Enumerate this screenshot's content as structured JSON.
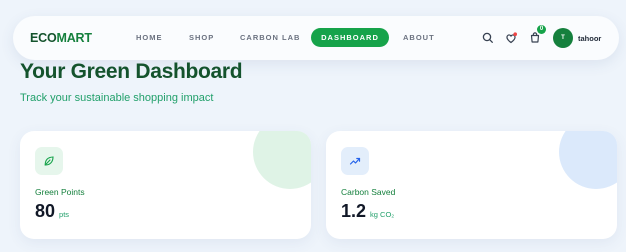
{
  "nav": {
    "logo_eco": "ECO",
    "logo_mart": "MART",
    "links": [
      "HOME",
      "SHOP",
      "CARBON LAB"
    ],
    "active": "DASHBOARD",
    "about": "ABOUT",
    "cart_count": "0",
    "avatar_initial": "T",
    "username": "tahoor",
    "icons": [
      "search-icon",
      "heart-icon",
      "cart-icon"
    ]
  },
  "page": {
    "title": "Your Green Dashboard",
    "subtitle": "Track your sustainable shopping impact"
  },
  "cards": [
    {
      "icon": "leaf-icon",
      "label": "Green Points",
      "value": "80",
      "unit": "pts"
    },
    {
      "icon": "trending-up-icon",
      "label": "Carbon Saved",
      "value": "1.2",
      "unit": "kg CO₂"
    }
  ],
  "colors": {
    "brand": "#15803d",
    "accent": "#16a34a",
    "background": "#eef4fb"
  }
}
